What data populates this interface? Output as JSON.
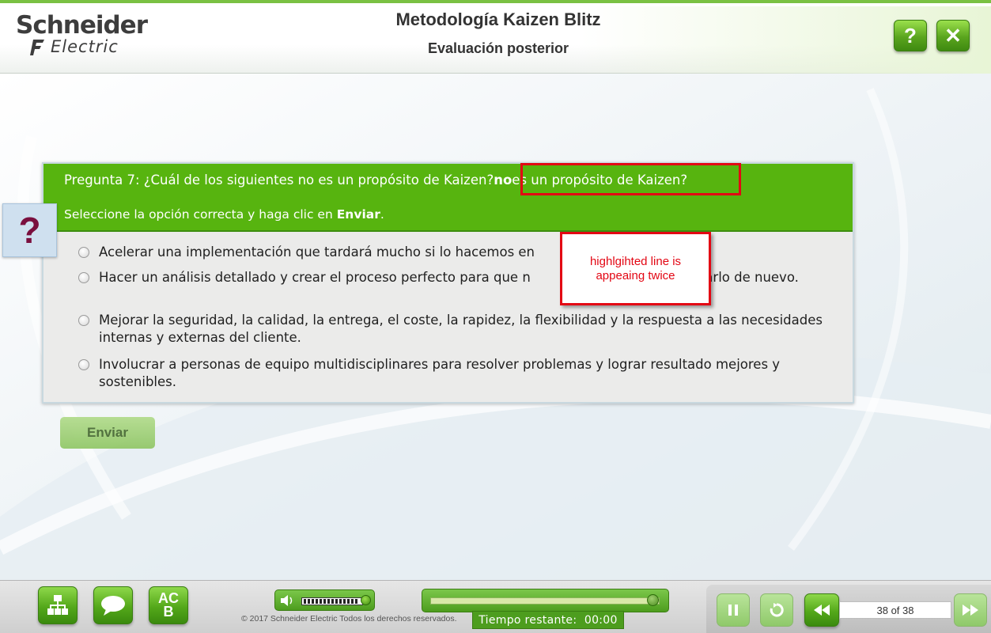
{
  "header": {
    "logo_top": "Schneider",
    "logo_bottom": "Electric",
    "title": "Metodología Kaizen Blitz",
    "subtitle": "Evaluación posterior",
    "help_label": "?",
    "close_label": "✕"
  },
  "question": {
    "badge": "?",
    "prefix": "Pregunta 7: ¿Cuál de los siguientes no es un propósito de Kaizen?",
    "dup_bold": "no",
    "dup_rest": "es un propósito de Kaizen?",
    "instruction_prefix": "Seleccione la opción correcta y haga clic en ",
    "instruction_bold": "Enviar",
    "instruction_suffix": ".",
    "options": [
      "Acelerar una implementación que tardará mucho si lo hacemos en",
      "Hacer un análisis detallado y crear el proceso perfecto para que n                              er a tocarlo de nuevo.",
      "Mejorar la seguridad, la calidad, la entrega, el coste, la rapidez, la flexibilidad y la respuesta a las necesidades internas y externas del cliente.",
      "Involucrar a personas de equipo multidisciplinares para resolver problemas y lograr resultado mejores y sostenibles."
    ],
    "submit_label": "Enviar"
  },
  "annotation": {
    "note": "highlgihted line is appeaing twice"
  },
  "footer": {
    "menu_icon": "sitemap-icon",
    "chat_icon": "speech-bubble-icon",
    "glossary_label_top": "AC",
    "glossary_label_bottom": "B",
    "audio_icon": "speaker-icon",
    "copyright": "© 2017 Schneider Electric Todos los derechos reservados.",
    "timer_label": "Tiempo restante:",
    "timer_value": "00:00",
    "page_counter": "38 of 38",
    "progress_fraction": 0.97
  },
  "colors": {
    "accent_green": "#57b40f",
    "annotation_red": "#e30613",
    "question_mark": "#7a0f3e"
  }
}
